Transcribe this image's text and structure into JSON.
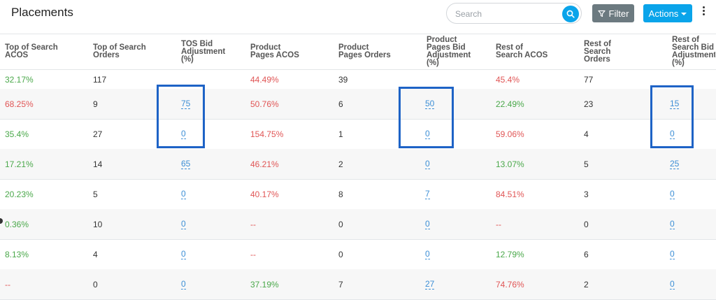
{
  "header": {
    "title": "Placements",
    "search_placeholder": "Search",
    "filter_label": "Filter",
    "actions_label": "Actions"
  },
  "columns": [
    "Top of Search ACOS",
    "Top of Search Orders",
    "TOS Bid Adjustment (%)",
    "Product Pages ACOS",
    "Product Pages Orders",
    "Product Pages Bid Adjustment (%)",
    "Rest of Search ACOS",
    "Rest of Search Orders",
    "Rest of Search Bid Adjustment (%)"
  ],
  "rows": [
    [
      "32.17%",
      "117",
      "",
      "44.49%",
      "39",
      "",
      "45.4%",
      "77",
      ""
    ],
    [
      "68.25%",
      "9",
      "75",
      "50.76%",
      "6",
      "50",
      "22.49%",
      "23",
      "15"
    ],
    [
      "35.4%",
      "27",
      "0",
      "154.75%",
      "1",
      "0",
      "59.06%",
      "4",
      "0"
    ],
    [
      "17.21%",
      "14",
      "65",
      "46.21%",
      "2",
      "0",
      "13.07%",
      "5",
      "25"
    ],
    [
      "20.23%",
      "5",
      "0",
      "40.17%",
      "8",
      "7",
      "84.51%",
      "3",
      "0"
    ],
    [
      "0.36%",
      "10",
      "0",
      "--",
      "0",
      "0",
      "--",
      "0",
      "0"
    ],
    [
      "8.13%",
      "4",
      "0",
      "--",
      "0",
      "0",
      "12.79%",
      "6",
      "0"
    ],
    [
      "--",
      "0",
      "0",
      "37.19%",
      "7",
      "27",
      "74.76%",
      "2",
      "0"
    ]
  ],
  "row_colors": [
    [
      "green",
      "dark",
      "link",
      "red",
      "dark",
      "link",
      "red",
      "dark",
      "link"
    ],
    [
      "red",
      "dark",
      "link",
      "red",
      "dark",
      "link",
      "green",
      "dark",
      "link"
    ],
    [
      "green",
      "dark",
      "link",
      "red",
      "dark",
      "link",
      "red",
      "dark",
      "link"
    ],
    [
      "green",
      "dark",
      "link",
      "red",
      "dark",
      "link",
      "green",
      "dark",
      "link"
    ],
    [
      "green",
      "dark",
      "link",
      "red",
      "dark",
      "link",
      "red",
      "dark",
      "link"
    ],
    [
      "green",
      "dark",
      "link",
      "red",
      "dark",
      "link",
      "red",
      "dark",
      "link"
    ],
    [
      "green",
      "dark",
      "link",
      "red",
      "dark",
      "link",
      "green",
      "dark",
      "link"
    ],
    [
      "red",
      "dark",
      "link",
      "green",
      "dark",
      "link",
      "red",
      "dark",
      "link"
    ]
  ],
  "colors": {
    "green": "#4aa84a",
    "red": "#e05555",
    "link": "#3d8fd6",
    "highlight": "#1e63c6",
    "primary": "#0aa4ea",
    "filter": "#6c7a80"
  }
}
